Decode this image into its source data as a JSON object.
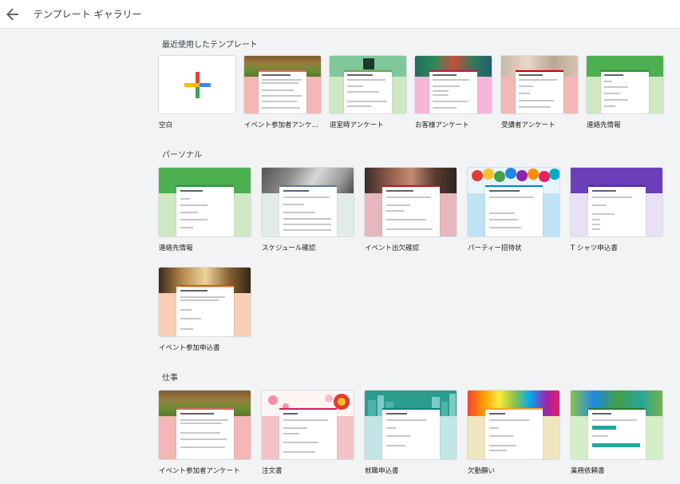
{
  "header": {
    "title": "テンプレート ギャラリー",
    "back_icon": "arrow-back-icon"
  },
  "sections": [
    {
      "title": "最近使用したテンプレート"
    },
    {
      "title": "パーソナル"
    },
    {
      "title": "仕事"
    }
  ],
  "recent": [
    {
      "label": "空白"
    },
    {
      "label": "イベント参加者アンケ..."
    },
    {
      "label": "退室時アンケート"
    },
    {
      "label": "お客様アンケート"
    },
    {
      "label": "受講者アンケート"
    },
    {
      "label": "連絡先情報"
    }
  ],
  "personal": [
    {
      "label": "連絡先情報"
    },
    {
      "label": "スケジュール確認"
    },
    {
      "label": "イベント出欠確認"
    },
    {
      "label": "パーティー招待状"
    },
    {
      "label": "T シャツ申込書"
    },
    {
      "label": "イベント参加申込書"
    }
  ],
  "work": [
    {
      "label": "イベント参加者アンケート"
    },
    {
      "label": "注文書"
    },
    {
      "label": "就職申込書"
    },
    {
      "label": "欠勤願い"
    },
    {
      "label": "業務依頼書"
    }
  ]
}
